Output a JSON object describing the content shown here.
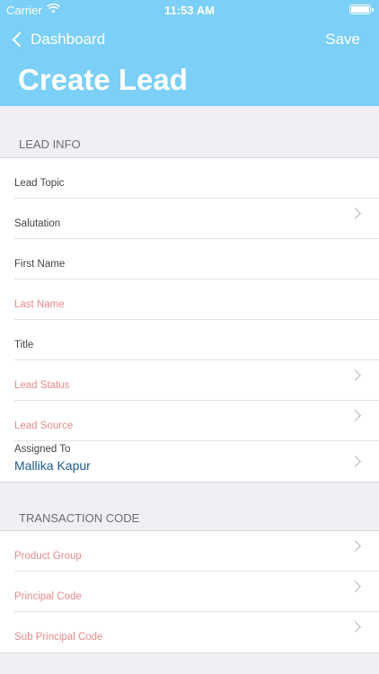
{
  "status_bar": {
    "carrier": "Carrier",
    "time": "11:53 AM"
  },
  "nav": {
    "back_label": "Dashboard",
    "save_label": "Save",
    "title": "Create Lead"
  },
  "lead_info": {
    "header": "LEAD INFO",
    "rows": [
      {
        "label": "Lead Topic"
      },
      {
        "label": "Salutation"
      },
      {
        "label": "First Name"
      },
      {
        "label": "Last Name"
      },
      {
        "label": "Title"
      },
      {
        "label": "Lead Status"
      },
      {
        "label": "Lead Source"
      },
      {
        "label": "Assigned To",
        "value": "Mallika Kapur"
      }
    ]
  },
  "transaction_code": {
    "header": "TRANSACTION CODE",
    "rows": [
      {
        "label": "Product Group"
      },
      {
        "label": "Principal Code"
      },
      {
        "label": "Sub Principal Code"
      }
    ]
  },
  "colors": {
    "header_bg": "#7ccff6",
    "required_label": "#e98a8a",
    "value_text": "#1d5a8f"
  }
}
